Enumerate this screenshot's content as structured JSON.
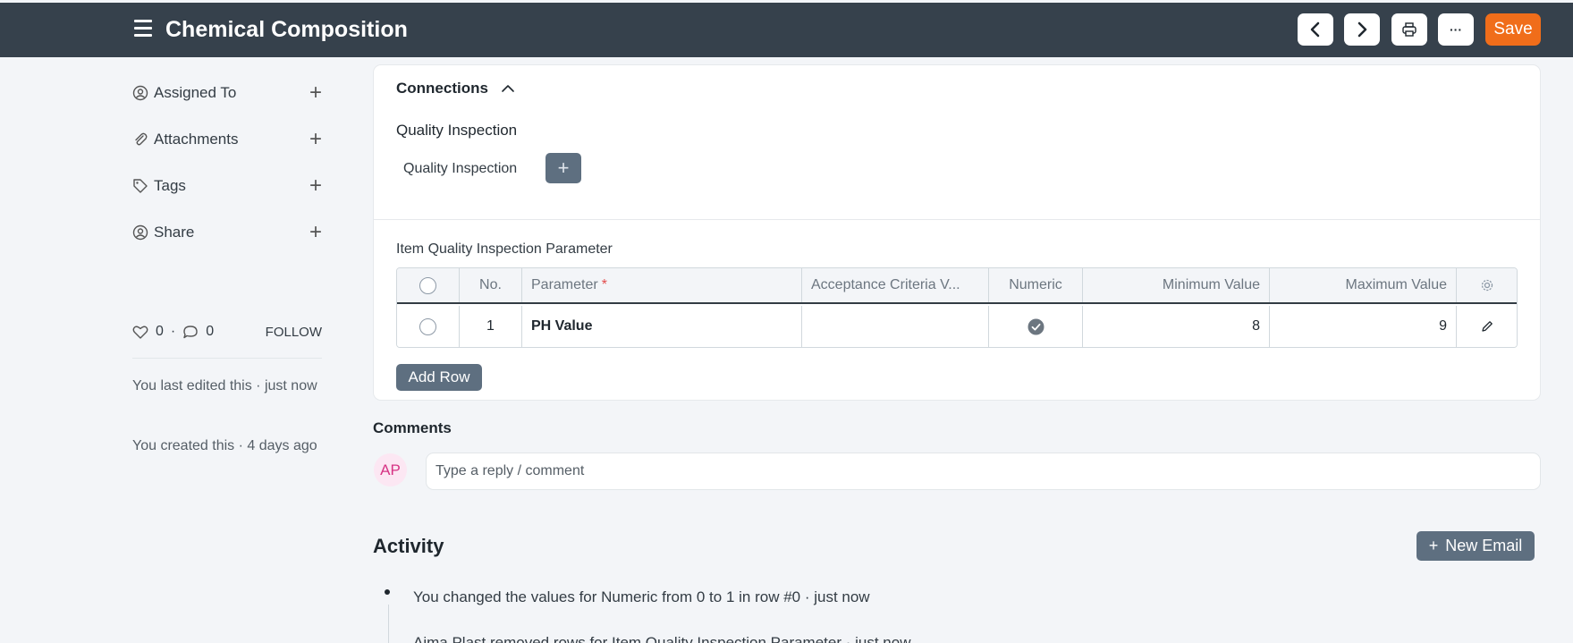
{
  "header": {
    "title": "Chemical Composition",
    "save_label": "Save",
    "more_label": "···"
  },
  "sidebar": {
    "items": [
      {
        "label": "Assigned To",
        "icon": "assign-icon"
      },
      {
        "label": "Attachments",
        "icon": "paperclip-icon"
      },
      {
        "label": "Tags",
        "icon": "tag-icon"
      },
      {
        "label": "Share",
        "icon": "share-icon"
      }
    ],
    "likes": "0",
    "comments_count": "0",
    "separator": "·",
    "follow_label": "FOLLOW",
    "last_edited": "You last edited this · just now",
    "created": "You created this · 4 days ago"
  },
  "connections": {
    "title": "Connections",
    "section_title": "Quality Inspection",
    "link_label": "Quality Inspection"
  },
  "table": {
    "title": "Item Quality Inspection Parameter",
    "columns": [
      "No.",
      "Parameter",
      "Acceptance Criteria V...",
      "Numeric",
      "Minimum Value",
      "Maximum Value"
    ],
    "required_marker": "*",
    "rows": [
      {
        "no": "1",
        "parameter": "PH Value",
        "acceptance": "",
        "numeric": true,
        "min": "8",
        "max": "9"
      }
    ],
    "add_row_label": "Add Row"
  },
  "comments": {
    "title": "Comments",
    "avatar_initials": "AP",
    "placeholder": "Type a reply / comment"
  },
  "activity": {
    "title": "Activity",
    "new_email_label": "New Email",
    "items": [
      "You changed the values for Numeric from 0 to 1 in row #0 · just now",
      "Aima Plast removed rows for Item Quality Inspection Parameter · just now"
    ]
  }
}
